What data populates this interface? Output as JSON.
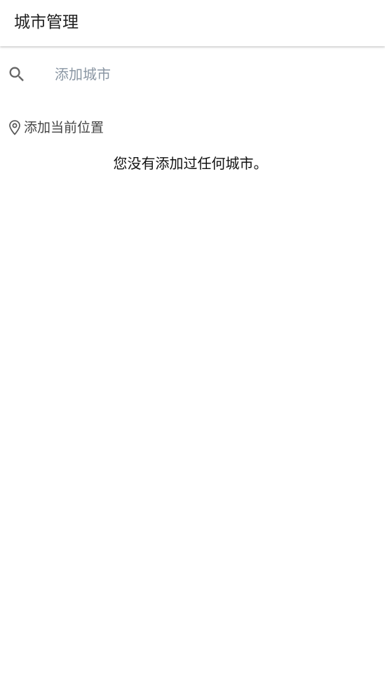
{
  "app_bar": {
    "title": "城市管理"
  },
  "search": {
    "icon": "search-icon",
    "placeholder": "添加城市",
    "value": ""
  },
  "add_current_location": {
    "icon": "location-pin-icon",
    "label": "添加当前位置"
  },
  "empty_state": {
    "message": "您没有添加过任何城市。"
  },
  "colors": {
    "placeholder": "#8a96a3",
    "icon": "#666666",
    "text": "#212121"
  }
}
